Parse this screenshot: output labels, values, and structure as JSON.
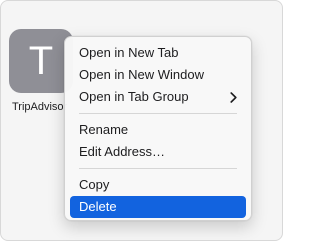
{
  "bookmark": {
    "letter": "T",
    "label": "TripAdvisor"
  },
  "context_menu": {
    "items": [
      {
        "label": "Open in New Tab"
      },
      {
        "label": "Open in New Window"
      },
      {
        "label": "Open in Tab Group",
        "submenu": true
      },
      {
        "label": "Rename"
      },
      {
        "label": "Edit Address…"
      },
      {
        "label": "Copy"
      },
      {
        "label": "Delete",
        "selected": true
      }
    ]
  },
  "colors": {
    "selection": "#1263df",
    "tile": "#8f8f96"
  }
}
